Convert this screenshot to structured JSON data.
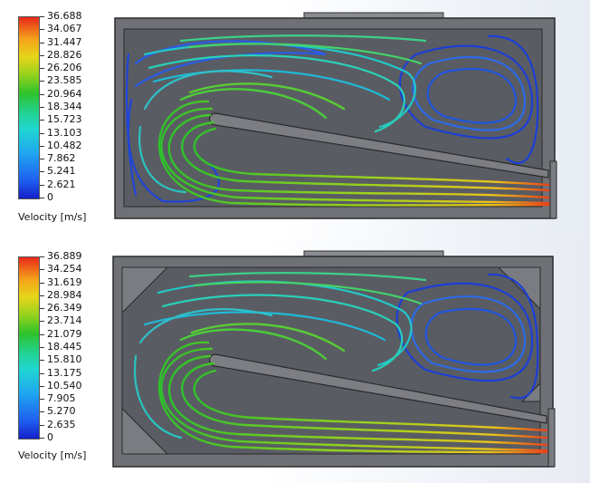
{
  "panels": [
    {
      "legend_title": "Velocity [m/s]",
      "ticks": [
        "36.688",
        "34.067",
        "31.447",
        "28.826",
        "26.206",
        "23.585",
        "20.964",
        "18.344",
        "15.723",
        "13.103",
        "10.482",
        "7.862",
        "5.241",
        "2.621",
        "0"
      ]
    },
    {
      "legend_title": "Velocity [m/s]",
      "ticks": [
        "36.889",
        "34.254",
        "31.619",
        "28.984",
        "26.349",
        "23.714",
        "21.079",
        "18.445",
        "15.810",
        "13.175",
        "10.540",
        "7.905",
        "5.270",
        "2.635",
        "0"
      ]
    }
  ],
  "colors": {
    "housing": "#6d6f75",
    "housing_edge": "#2a2a2a",
    "cavity": "#55575e",
    "baffle": "#7b7c82",
    "slow": "#1c3fd6",
    "medium": "#22c8c8",
    "fast": "#3bd23a",
    "faster": "#e8d21c",
    "fastest": "#e83a18"
  }
}
